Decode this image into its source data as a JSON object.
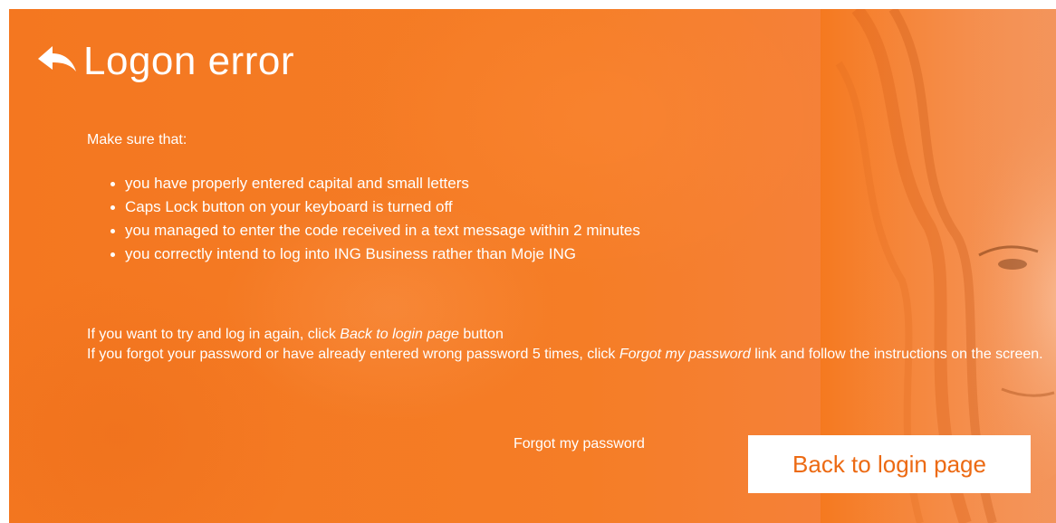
{
  "header": {
    "title": "Logon error",
    "back_icon": "back-arrow-icon"
  },
  "body": {
    "intro": "Make sure that:",
    "reasons": [
      "you have properly entered capital and small letters",
      "Caps Lock button on your keyboard is turned off",
      "you managed to enter the code received in a text message within 2 minutes",
      "you correctly intend to log into ING Business rather than Moje ING"
    ],
    "line1_prefix": "If you want to try and log in again, click ",
    "line1_emphasis": "Back to login page",
    "line1_suffix": " button",
    "line2_prefix": "If you forgot your password or have already entered wrong password 5 times, click ",
    "line2_emphasis": "Forgot my password",
    "line2_suffix": " link and follow the instructions on the screen."
  },
  "actions": {
    "forgot_password_label": "Forgot my password",
    "back_to_login_label": "Back to login page"
  },
  "colors": {
    "background": "#f5791f",
    "button_text": "#ec6a13",
    "text": "#ffffff"
  }
}
